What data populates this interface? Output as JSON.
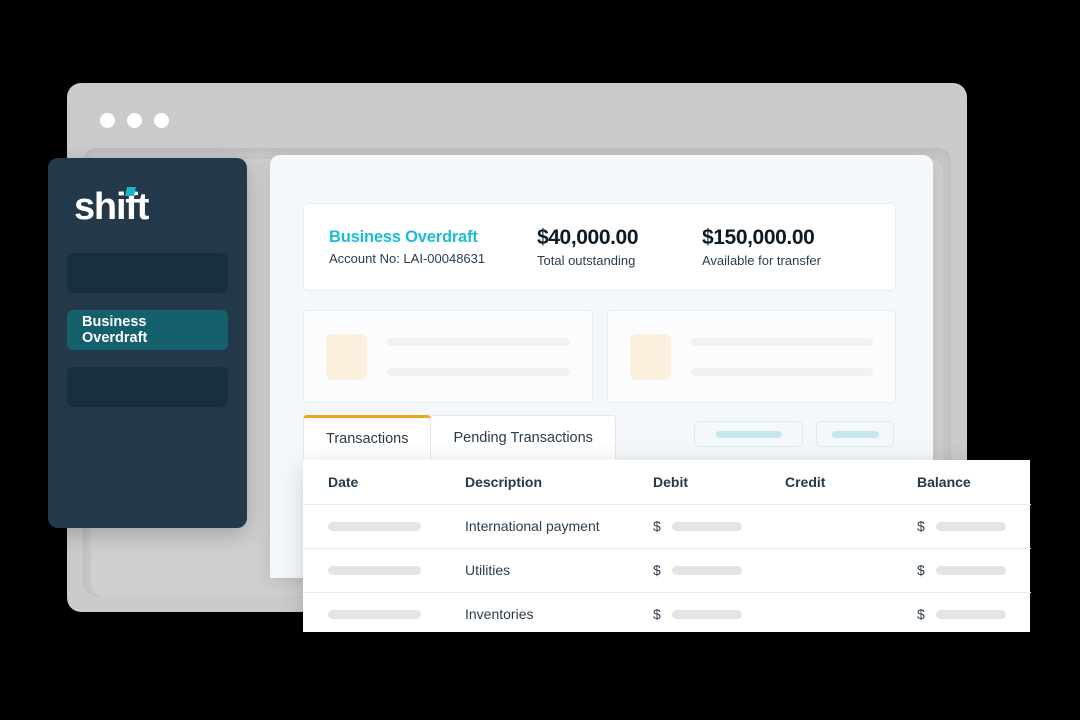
{
  "window": {
    "traffic_lights": [
      "close-dot",
      "minimize-dot",
      "maximize-dot"
    ]
  },
  "sidebar": {
    "logo_text": "shift",
    "items": [
      {
        "label": "",
        "name": "sidebar-item-placeholder-1",
        "active": false
      },
      {
        "label": "Business Overdraft",
        "name": "sidebar-item-business-overdraft",
        "active": true
      },
      {
        "label": "",
        "name": "sidebar-item-placeholder-2",
        "active": false
      }
    ]
  },
  "account": {
    "name": "Business Overdraft",
    "account_no": "Account No: LAI-00048631",
    "total_outstanding_amount": "$40,000.00",
    "total_outstanding_label": "Total outstanding",
    "available_amount": "$150,000.00",
    "available_label": "Available for transfer"
  },
  "tabs": [
    {
      "label": "Transactions",
      "active": true
    },
    {
      "label": "Pending Transactions",
      "active": false
    }
  ],
  "table": {
    "headers": [
      "Date",
      "Description",
      "Debit",
      "Credit",
      "Balance"
    ],
    "currency_symbol": "$",
    "rows": [
      {
        "date": "",
        "description": "International payment",
        "debit": "",
        "credit": "",
        "balance": ""
      },
      {
        "date": "",
        "description": "Utilities",
        "debit": "",
        "credit": "",
        "balance": ""
      },
      {
        "date": "",
        "description": "Inventories",
        "debit": "",
        "credit": "",
        "balance": ""
      }
    ]
  },
  "colors": {
    "background": "#000000",
    "browser_chrome": "#cbcbcb",
    "app_panel": "#f4f8fb",
    "sidebar": "#23394a",
    "sidebar_item": "#17303f",
    "sidebar_item_active": "#15606d",
    "accent_teal": "#1bbcd4",
    "logo_dot": "#17b6c9",
    "tab_active_border": "#f1a325",
    "skeleton_gray": "#e4e4e6",
    "skeleton_cream": "#fbf0dd",
    "skeleton_teal": "#c5e7ee"
  }
}
